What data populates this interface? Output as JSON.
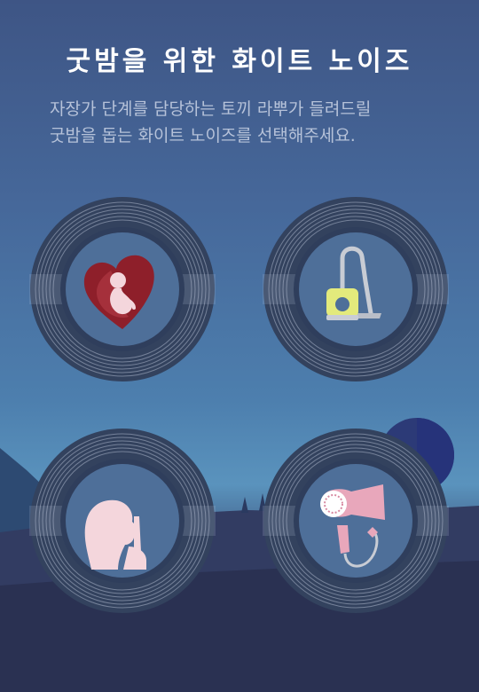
{
  "header": {
    "title": "굿밤을 위한 화이트 노이즈",
    "description_lines": [
      "자장가 단계를 담당하는 토끼 라뿌가 들려드릴",
      "굿밤을 돕는 화이트 노이즈를 선택해주세요."
    ]
  },
  "noise_options": [
    {
      "id": "womb",
      "icon": "baby-in-womb-icon"
    },
    {
      "id": "vacuum",
      "icon": "vacuum-cleaner-icon"
    },
    {
      "id": "shush",
      "icon": "shushing-face-icon"
    },
    {
      "id": "hairdryer",
      "icon": "hair-dryer-icon"
    }
  ],
  "colors": {
    "ring_dark": "#33425e",
    "disc_center": "#4e6f99",
    "heart": "#8e1f2a",
    "vacuum_body": "#e3ea7c",
    "dryer_pink": "#e8a7bb",
    "face_pink": "#f4d6dc"
  }
}
